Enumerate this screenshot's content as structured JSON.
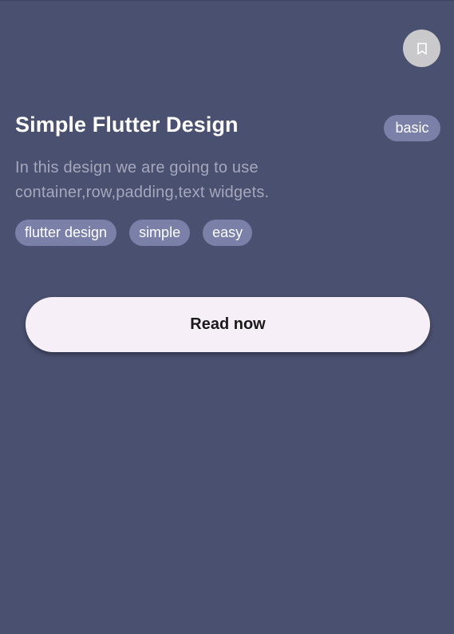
{
  "card": {
    "title": "Simple Flutter Design",
    "badge": "basic",
    "description": "In this design we are going to use container,row,padding,text widgets.",
    "tags": [
      "flutter design",
      "simple",
      "easy"
    ],
    "bookmark_icon": "bookmark-outline-icon",
    "read_button_label": "Read now"
  },
  "colors": {
    "background": "#4a5070",
    "chip": "#7b80a8",
    "button": "#f7eff7",
    "bookmark_circle": "#c9c9cc"
  }
}
